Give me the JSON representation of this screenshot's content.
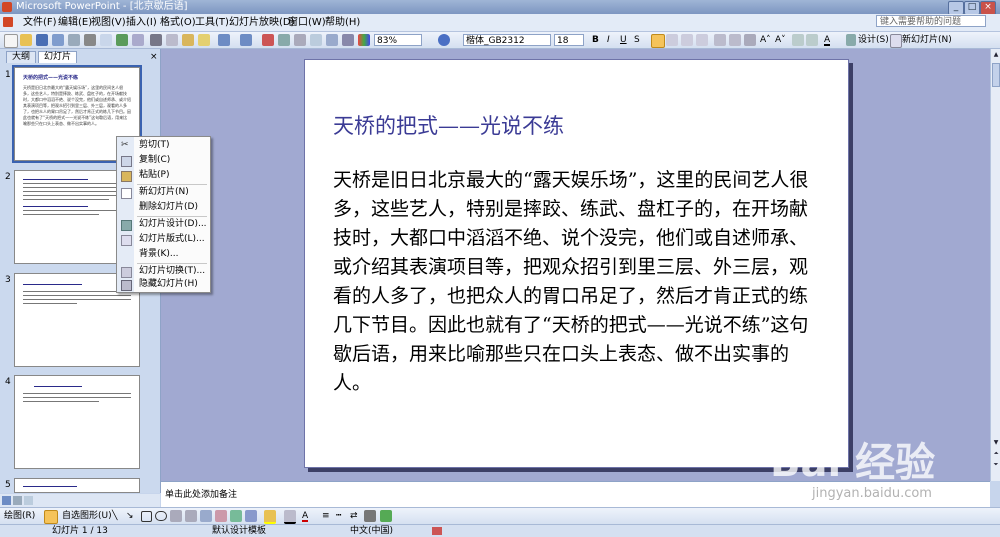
{
  "window": {
    "title": "Microsoft PowerPoint - [北京歇后语]",
    "help_placeholder": "键入需要帮助的问题",
    "minimize": "_",
    "maximize": "□",
    "close": "×"
  },
  "menu": [
    "文件(F)",
    "编辑(E)",
    "视图(V)",
    "插入(I)",
    "格式(O)",
    "工具(T)",
    "幻灯片放映(D)",
    "窗口(W)",
    "帮助(H)"
  ],
  "toolbar": {
    "zoom": "83%",
    "font_name": "楷体_GB2312",
    "font_size": "18",
    "bold": "B",
    "italic": "I",
    "underline": "U",
    "shadow": "S",
    "design_label": "设计(S)",
    "new_slide_label": "新幻灯片(N)"
  },
  "outline_tabs": [
    "大纲",
    "幻灯片"
  ],
  "thumbnails": [
    {
      "num": "1",
      "title": "天桥的把式——光说不练",
      "body": "天桥是旧日北京最大的“露天娱乐场”，这里的民间艺人很多，这些艺人，特别是摔跤、练武、盘杠子的，在开场献技时，大都口中滔滔不绝、说个没完，他们或自述师承、或介绍其表演项目等，把观众招引到里三层、外三层，观看的人多了，也把众人的胃口吊足了，然后才肯正式的练几下节目。因此也就有了“天桥的把式——光说不练”这句歇后语，用来比喻那些只在口头上表态、做不出实事的人。"
    },
    {
      "num": "2",
      "title": "",
      "body": ""
    },
    {
      "num": "3",
      "title": "",
      "body": ""
    },
    {
      "num": "4",
      "title": "",
      "body": ""
    },
    {
      "num": "5",
      "title": "",
      "body": ""
    }
  ],
  "slide": {
    "title": "天桥的把式——光说不练",
    "body": "天桥是旧日北京最大的“露天娱乐场”，这里的民间艺人很多，这些艺人，特别是摔跤、练武、盘杠子的，在开场献技时，大都口中滔滔不绝、说个没完，他们或自述师承、或介绍其表演项目等，把观众招引到里三层、外三层，观看的人多了，也把众人的胃口吊足了，然后才肯正式的练几下节目。因此也就有了“天桥的把式——光说不练”这句歇后语，用来比喻那些只在口头上表态、做不出实事的人。"
  },
  "notes_placeholder": "单击此处添加备注",
  "context_menu": [
    {
      "label": "剪切(T)",
      "icon": "scissors-icon",
      "disabled": false
    },
    {
      "label": "复制(C)",
      "icon": "copy-icon",
      "disabled": false
    },
    {
      "label": "粘贴(P)",
      "icon": "paste-icon",
      "disabled": false
    },
    {
      "label": "新幻灯片(N)",
      "icon": "new-slide-icon",
      "disabled": false
    },
    {
      "label": "删除幻灯片(D)",
      "icon": "delete-slide-icon",
      "disabled": false
    },
    {
      "label": "幻灯片设计(D)...",
      "icon": "slide-design-icon",
      "disabled": false
    },
    {
      "label": "幻灯片版式(L)...",
      "icon": "slide-layout-icon",
      "disabled": false
    },
    {
      "label": "背景(K)...",
      "icon": "background-icon",
      "disabled": false
    },
    {
      "label": "幻灯片切换(T)...",
      "icon": "transition-icon",
      "disabled": false
    },
    {
      "label": "隐藏幻灯片(H)",
      "icon": "hide-slide-icon",
      "disabled": false
    }
  ],
  "drawbar": {
    "draw_label": "绘图(R)",
    "autoshapes_label": "自选图形(U)"
  },
  "status": {
    "slide_counter": "幻灯片 1 / 13",
    "template": "默认设计模板",
    "language": "中文(中国)"
  },
  "watermark": {
    "brand": "Bai 经验",
    "url": "jingyan.baidu.com"
  },
  "colors": {
    "title_blue": "#3b3b95",
    "edit_bg": "#a1a9d1",
    "selection": "#3a62b0"
  }
}
